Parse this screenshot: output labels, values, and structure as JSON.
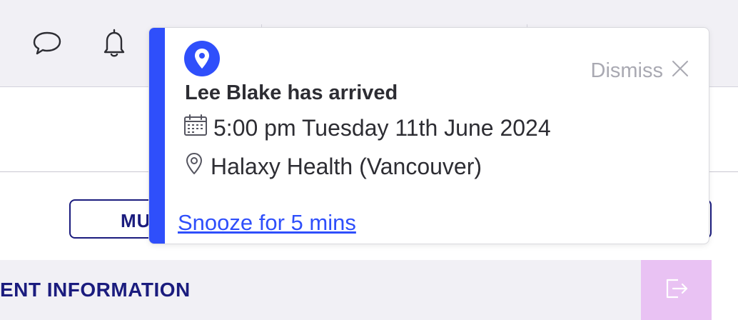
{
  "topbar": {
    "icons": {
      "chat": "chat-bubble-icon",
      "notifications": "bell-icon"
    }
  },
  "form": {
    "button_label": "MU",
    "section_title": "ENT INFORMATION",
    "exit_icon": "exit-icon"
  },
  "toast": {
    "badge_icon": "location-pin-icon",
    "title": "Lee Blake has arrived",
    "dismiss_label": "Dismiss",
    "datetime": "5:00 pm Tuesday 11th June 2024",
    "location": "Halaxy Health (Vancouver)",
    "snooze_label": "Snooze for 5 mins",
    "accent_color": "#2f4ffb"
  },
  "colors": {
    "brand_navy": "#1b1c7e",
    "accent_blue": "#2f4ffb",
    "exit_button_bg": "#e9c2f3",
    "bar_bg": "#f1f0f5"
  }
}
